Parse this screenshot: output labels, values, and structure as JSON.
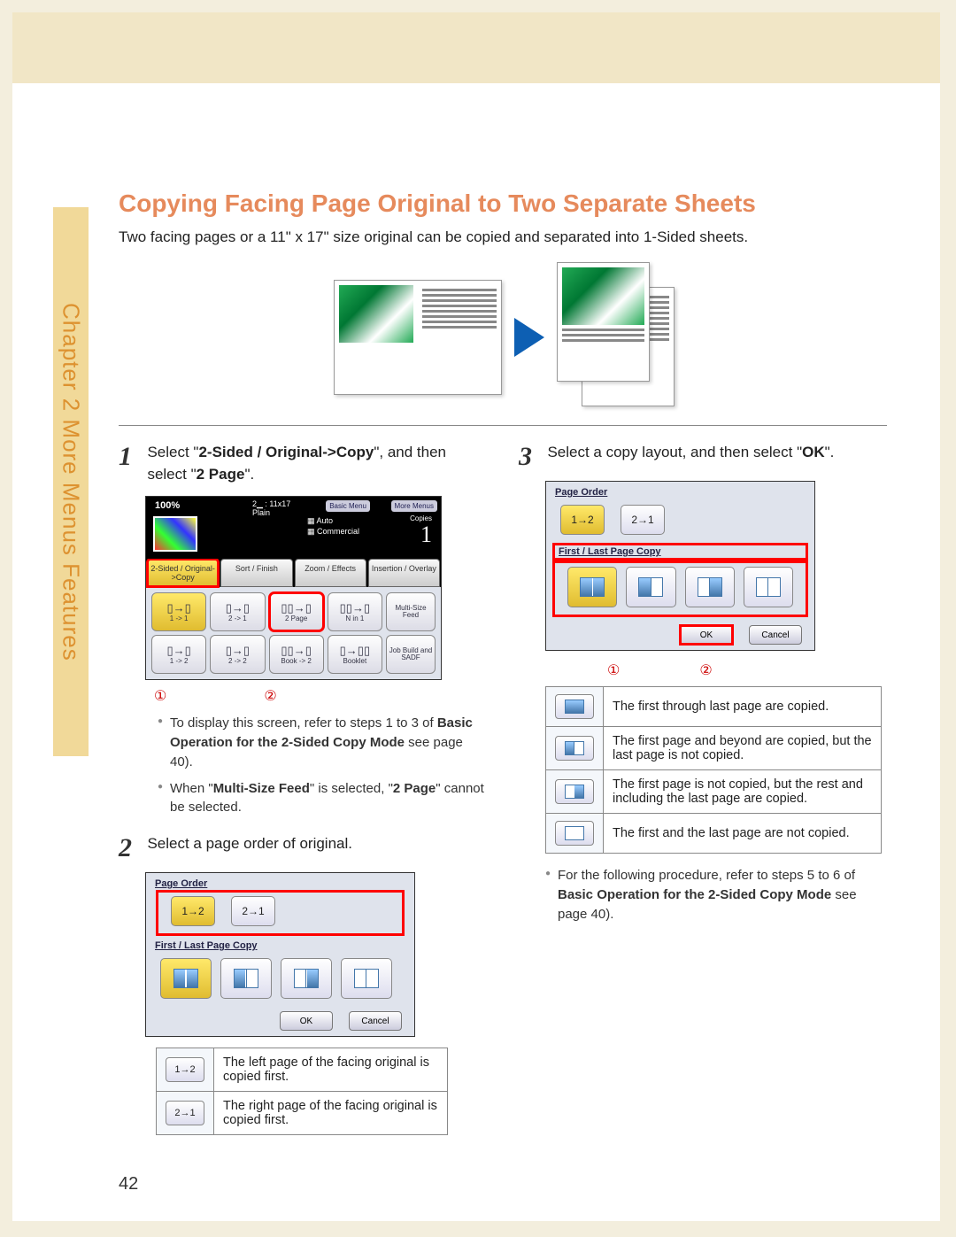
{
  "sidebar": {
    "label": "Chapter 2   More Menus Features"
  },
  "title": "Copying Facing Page Original to Two Separate Sheets",
  "intro": "Two facing pages or a 11\" x 17\" size original can be copied and separated into 1-Sided sheets.",
  "page_number": "42",
  "step1": {
    "num": "1",
    "text_a": "Select \"",
    "bold_a": "2-Sided / Original->Copy",
    "text_b": "\", and then select \"",
    "bold_b": "2 Page",
    "text_c": "\"."
  },
  "step1_bullets": [
    {
      "pre": "To display this screen, refer to steps 1 to 3 of ",
      "bold": "Basic Operation for the 2-Sided Copy Mode",
      "post": " see page 40)."
    },
    {
      "pre": "When \"",
      "bold": "Multi-Size Feed",
      "mid": "\" is selected, \"",
      "bold2": "2 Page",
      "post": "\" cannot be selected."
    }
  ],
  "step2": {
    "num": "2",
    "text": "Select a page order of original."
  },
  "step3": {
    "num": "3",
    "text_a": "Select a copy layout, and then select \"",
    "bold": "OK",
    "text_b": "\"."
  },
  "step3_bullet": {
    "pre": "For the following procedure, refer to steps 5 to 6 of ",
    "bold": "Basic Operation for the 2-Sided Copy Mode",
    "post": " see page 40)."
  },
  "markers": {
    "m1": "①",
    "m2": "②"
  },
  "screen1": {
    "percent": "100%",
    "tray_line1": "2▁ : 11x17",
    "tray_line2": "Plain",
    "basic": "Basic Menu",
    "more": "More Menus",
    "auto": "▦ Auto",
    "commercial": "▦ Commercial",
    "copies_label": "Copies",
    "copies": "1",
    "tabs": [
      "2-Sided /\nOriginal->Copy",
      "Sort / Finish",
      "Zoom / Effects",
      "Insertion /\nOverlay"
    ],
    "row1": [
      "1 -> 1",
      "2 -> 1",
      "2 Page",
      "N in 1"
    ],
    "row2": [
      "1 -> 2",
      "2 -> 2",
      "Book -> 2",
      "Booklet"
    ],
    "side1": "Multi-Size\nFeed",
    "side2": "Job Build\nand SADF"
  },
  "screen2": {
    "hdr1": "Page Order",
    "ord1": "1→2",
    "ord2": "2→1",
    "hdr2": "First / Last Page Copy",
    "ok": "OK",
    "cancel": "Cancel"
  },
  "screen3": {
    "hdr1": "Page Order",
    "ord1": "1→2",
    "ord2": "2→1",
    "hdr2": "First / Last Page Copy",
    "ok": "OK",
    "cancel": "Cancel"
  },
  "table_step2": [
    {
      "icon": "1→2",
      "desc": "The left page of the facing original is copied first."
    },
    {
      "icon": "2→1",
      "desc": "The right page of the facing original is copied first."
    }
  ],
  "table_step3": [
    {
      "desc": "The first through last page are copied."
    },
    {
      "desc": "The first page and beyond are copied, but the last page is not copied."
    },
    {
      "desc": "The first page is not copied, but the rest and including the last page are copied."
    },
    {
      "desc": "The first and the last page are not copied."
    }
  ]
}
